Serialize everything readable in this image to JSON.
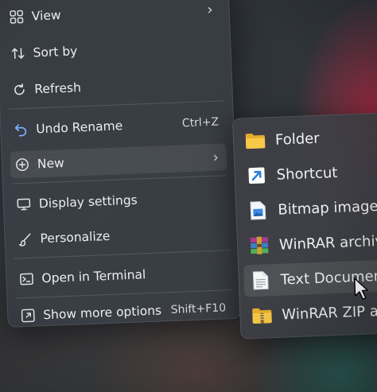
{
  "context_menu": {
    "items": [
      {
        "label": "View",
        "has_submenu": true
      },
      {
        "label": "Sort by"
      },
      {
        "label": "Refresh"
      },
      {
        "label": "Undo Rename",
        "shortcut": "Ctrl+Z"
      },
      {
        "label": "New",
        "has_submenu": true
      },
      {
        "label": "Display settings"
      },
      {
        "label": "Personalize"
      },
      {
        "label": "Open in Terminal"
      },
      {
        "label": "Show more options",
        "shortcut": "Shift+F10"
      }
    ],
    "submenu_arrow": "›"
  },
  "new_submenu": {
    "items": [
      {
        "label": "Folder",
        "icon": "folder-icon"
      },
      {
        "label": "Shortcut",
        "icon": "shortcut-icon"
      },
      {
        "label": "Bitmap image",
        "icon": "bitmap-image-icon"
      },
      {
        "label": "WinRAR archive",
        "icon": "winrar-archive-icon"
      },
      {
        "label": "Text Document",
        "icon": "text-document-icon"
      },
      {
        "label": "WinRAR ZIP archive",
        "icon": "winrar-zip-icon"
      }
    ]
  },
  "colors": {
    "menu_bg": "#3a3e44",
    "folder_yellow": "#f5c542",
    "shortcut_blue": "#2f7fd6",
    "accent_red": "#c82846"
  }
}
